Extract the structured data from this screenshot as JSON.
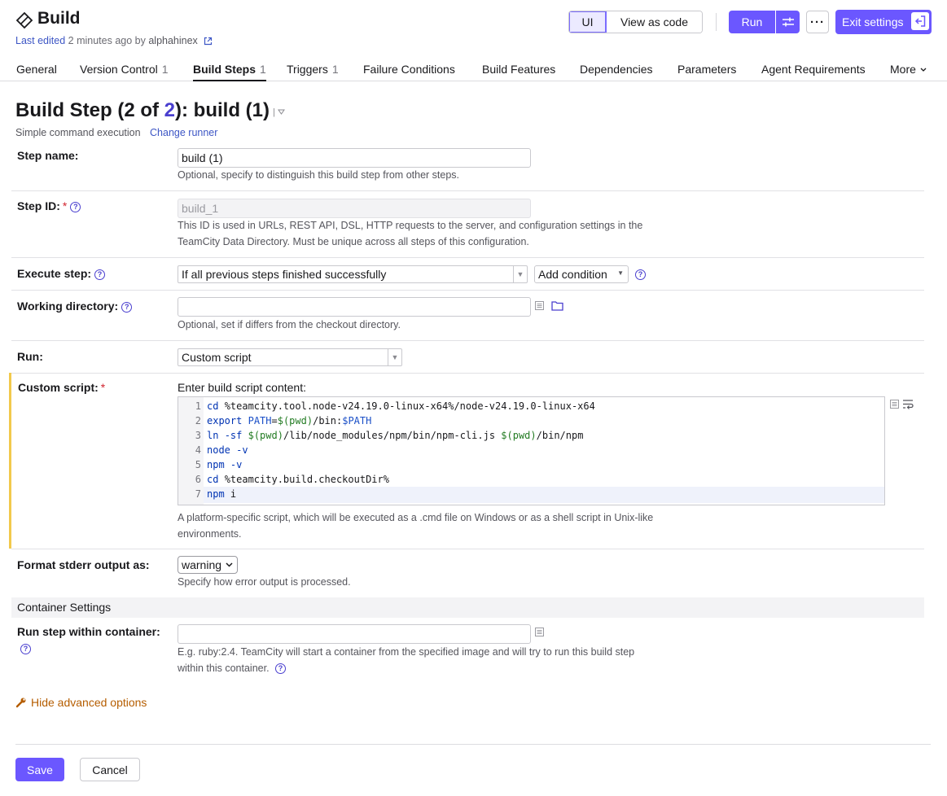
{
  "header": {
    "title": "Build",
    "last_edited_link": "Last edited",
    "last_edited_time": "2 minutes ago by",
    "last_edited_user": "alphahinex",
    "view_ui": "UI",
    "view_code": "View as code",
    "run_label": "Run",
    "more_label": "···",
    "exit_label": "Exit settings"
  },
  "tabs": [
    {
      "label": "General",
      "count": ""
    },
    {
      "label": "Version Control",
      "count": "1"
    },
    {
      "label": "Build Steps",
      "count": "1"
    },
    {
      "label": "Triggers",
      "count": "1"
    },
    {
      "label": "Failure Conditions",
      "count": ""
    },
    {
      "label": "Build Features",
      "count": ""
    },
    {
      "label": "Dependencies",
      "count": ""
    },
    {
      "label": "Parameters",
      "count": ""
    },
    {
      "label": "Agent Requirements",
      "count": ""
    },
    {
      "label": "More",
      "count": ""
    }
  ],
  "step": {
    "heading_pre": "Build Step (2 of ",
    "heading_num": "2",
    "heading_post": "): build (1)",
    "runner_desc": "Simple command execution",
    "change_runner": "Change runner"
  },
  "form": {
    "step_name": {
      "label": "Step name:",
      "value": "build (1)",
      "hint": "Optional, specify to distinguish this build step from other steps."
    },
    "step_id": {
      "label": "Step ID:",
      "value": "build_1",
      "hint1": "This ID is used in URLs, REST API, DSL, HTTP requests to the server, and configuration settings in the",
      "hint2": "TeamCity Data Directory. Must be unique across all steps of this configuration."
    },
    "execute_step": {
      "label": "Execute step:",
      "value": "If all previous steps finished successfully",
      "add_condition": "Add condition"
    },
    "working_dir": {
      "label": "Working directory:",
      "value": "",
      "hint": "Optional, set if differs from the checkout directory."
    },
    "run": {
      "label": "Run:",
      "value": "Custom script"
    },
    "custom_script": {
      "label": "Custom script:",
      "prompt": "Enter build script content:",
      "lines": [
        "cd %teamcity.tool.node-v24.19.0-linux-x64%/node-v24.19.0-linux-x64",
        "export PATH=$(pwd)/bin:$PATH",
        "ln -sf $(pwd)/lib/node_modules/npm/bin/npm-cli.js $(pwd)/bin/npm",
        "node -v",
        "npm -v",
        "cd %teamcity.build.checkoutDir%",
        "npm i"
      ],
      "hint1": "A platform-specific script, which will be executed as a .cmd file on Windows or as a shell script in Unix-like",
      "hint2": "environments."
    },
    "stderr": {
      "label": "Format stderr output as:",
      "value": "warning",
      "hint": "Specify how error output is processed."
    },
    "container_section": "Container Settings",
    "container": {
      "label": "Run step within container:",
      "value": "",
      "hint1": "E.g. ruby:2.4. TeamCity will start a container from the specified image and will try to run this build step",
      "hint2": "within this container."
    }
  },
  "advanced_link": "Hide advanced options",
  "footer": {
    "save": "Save",
    "cancel": "Cancel"
  },
  "colors": {
    "accent": "#6b57ff",
    "link": "#3d56c5",
    "required": "#d1242f",
    "advanced": "#b55d00",
    "marker": "#f2c94c"
  }
}
